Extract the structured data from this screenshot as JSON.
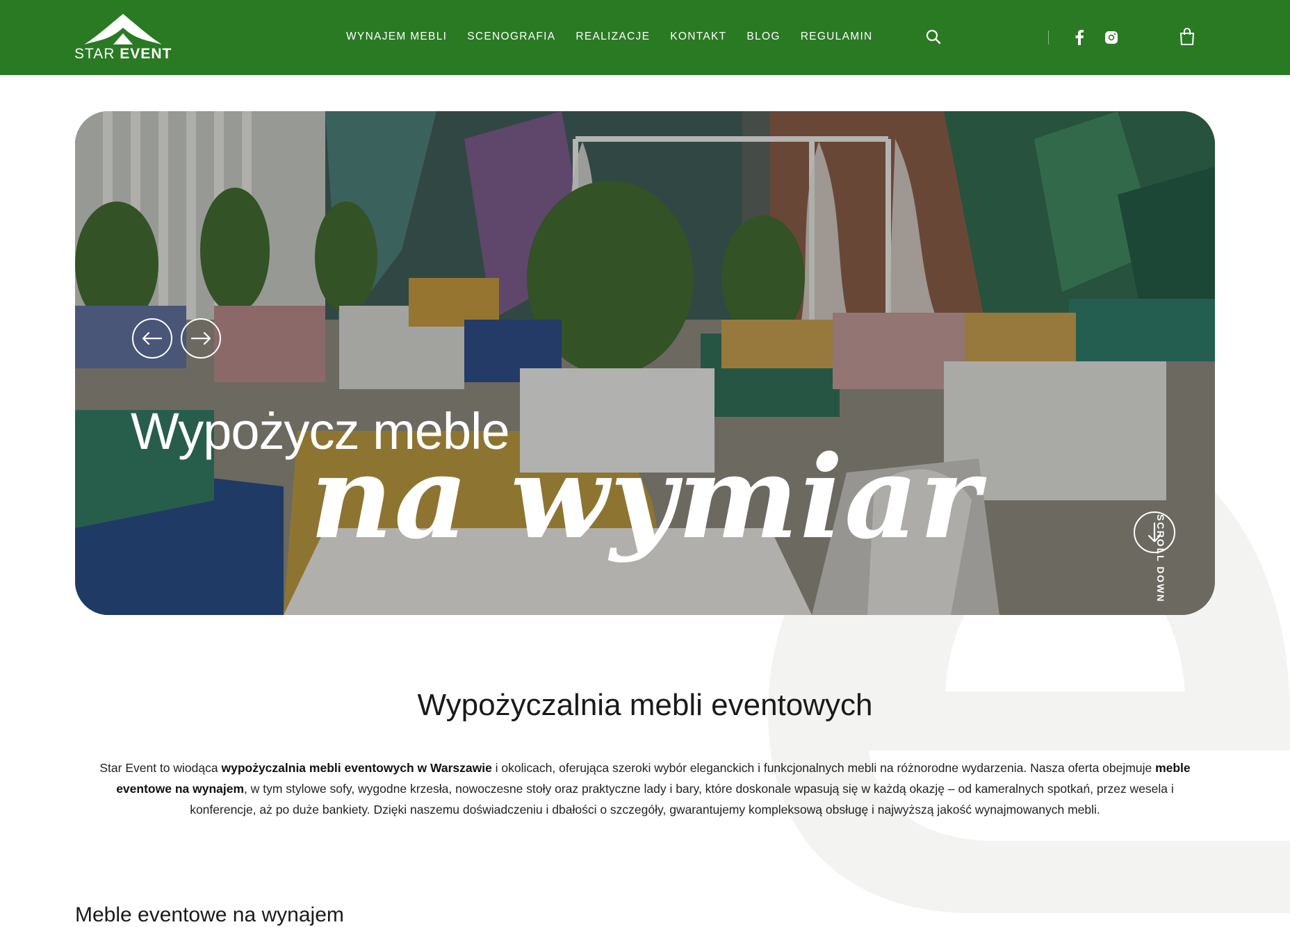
{
  "brand": {
    "light": "STAR",
    "bold": "EVENT",
    "color": "#2a7a24"
  },
  "nav": {
    "items": [
      {
        "label": "WYNAJEM MEBLI"
      },
      {
        "label": "SCENOGRAFIA"
      },
      {
        "label": "REALIZACJE"
      },
      {
        "label": "KONTAKT"
      },
      {
        "label": "BLOG"
      },
      {
        "label": "REGULAMIN"
      }
    ]
  },
  "header_icons": [
    "search-icon",
    "facebook-icon",
    "instagram-icon",
    "cart-icon"
  ],
  "hero": {
    "line1": "Wypożycz meble",
    "line2": "na wymiar",
    "scroll_label": "SCROLL DOWN"
  },
  "intro": {
    "title": "Wypożyczalnia mebli eventowych",
    "p1": "Star Event to wiodąca ",
    "b1": "wypożyczalnia mebli eventowych w Warszawie",
    "p2": " i okolicach, oferująca szeroki wybór eleganckich i funkcjonalnych mebli na różnorodne wydarzenia. Nasza oferta obejmuje ",
    "b2": "meble eventowe na wynajem",
    "p3": ", w tym stylowe sofy, wygodne krzesła, nowoczesne stoły oraz praktyczne lady i bary, które doskonale wpasują się w każdą okazję – od kameralnych spotkań, przez wesela i konferencje, aż po duże bankiety. Dzięki naszemu doświadczeniu i dbałości o szczegóły, gwarantujemy kompleksową obsługę i najwyższą jakość wynajmowanych mebli."
  },
  "next_section": {
    "title": "Meble eventowe na wynajem"
  }
}
